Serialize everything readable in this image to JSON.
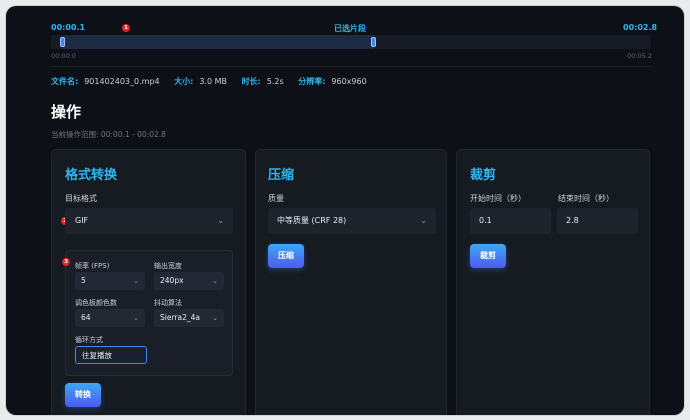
{
  "timeline": {
    "start_label": "00:00.1",
    "section_label": "已选片段",
    "end_label": "00:02.8",
    "tick_start": "00:00.0",
    "tick_end": "00:05.2",
    "selection_start_fraction": 0.019,
    "selection_end_fraction": 0.538
  },
  "file_info": {
    "name_key": "文件名:",
    "name_value": "901402403_0.mp4",
    "size_key": "大小:",
    "size_value": "3.0 MB",
    "duration_key": "时长:",
    "duration_value": "5.2s",
    "resolution_key": "分辨率:",
    "resolution_value": "960x960"
  },
  "operations": {
    "title": "操作",
    "range_text": "当前操作范围: 00:00.1 - 00:02.8"
  },
  "convert": {
    "title": "格式转换",
    "target_label": "目标格式",
    "target_value": "GIF",
    "fps_label": "帧率 (FPS)",
    "fps_value": "5",
    "width_label": "输出宽度",
    "width_value": "240px",
    "palette_label": "调色板颜色数",
    "palette_value": "64",
    "dither_label": "抖动算法",
    "dither_value": "Sierra2_4a",
    "loop_label": "循环方式",
    "loop_value": "往复播放",
    "button": "转换"
  },
  "compress": {
    "title": "压缩",
    "quality_label": "质量",
    "quality_value": "中等质量 (CRF 28)",
    "button": "压缩"
  },
  "trim": {
    "title": "裁剪",
    "start_label": "开始时间（秒）",
    "start_value": "0.1",
    "end_label": "结束时间（秒）",
    "end_value": "2.8",
    "button": "裁剪"
  },
  "badges": [
    "1",
    "2",
    "3"
  ],
  "colors": {
    "accent": "#2fb5f0",
    "background": "#0d1117",
    "card": "#161b22",
    "badge": "#e5202a",
    "button_from": "#3fa7f5",
    "button_to": "#4c5bf0"
  },
  "icons": {
    "dropdown": "chevron-down-icon"
  }
}
